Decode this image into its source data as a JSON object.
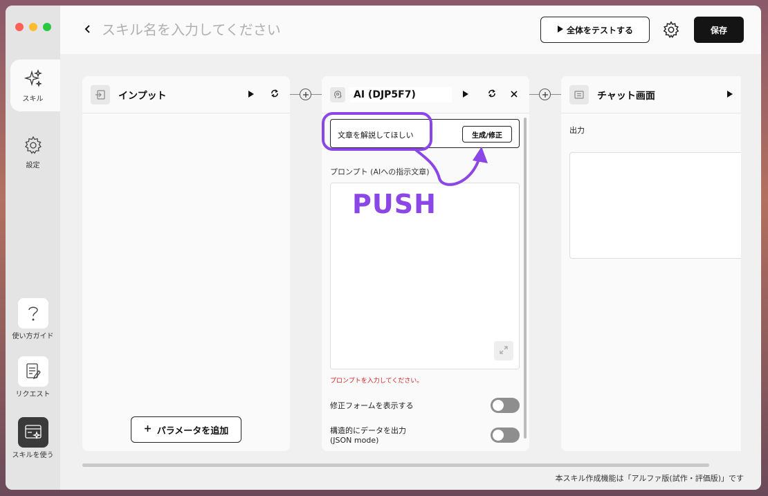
{
  "sidebar": {
    "items": [
      {
        "label": "スキル",
        "icon": "sparkle-icon"
      },
      {
        "label": "設定",
        "icon": "gear-icon"
      }
    ],
    "bottom": [
      {
        "label": "使い方ガイド",
        "icon": "question-icon"
      },
      {
        "label": "リクエスト",
        "icon": "note-edit-icon"
      },
      {
        "label": "スキルを使う",
        "icon": "skill-use-icon"
      }
    ]
  },
  "header": {
    "title_placeholder": "スキル名を入力してください",
    "test_all_label": "全体をテストする",
    "save_label": "保存"
  },
  "panels": {
    "input": {
      "title": "インプット",
      "add_param_label": "パラメータを追加"
    },
    "ai": {
      "title": "AI (DJP5F7)",
      "generate_input_value": "文章を解説してほしい",
      "generate_button_label": "生成/修正",
      "prompt_label": "プロンプト (AIへの指示文章)",
      "prompt_error": "プロンプトを入力してください。",
      "toggle_fix_form_label": "修正フォームを表示する",
      "toggle_json_label_1": "構造的にデータを出力",
      "toggle_json_label_2": "(JSON mode)"
    },
    "chat": {
      "title": "チャット画面",
      "output_label": "出力"
    }
  },
  "annotation": {
    "text": "PUSH",
    "color": "#8b46e6"
  },
  "footer": {
    "notice": "本スキル作成機能は「アルファ版(試作・評価版)」です"
  },
  "colors": {
    "accent": "#141414",
    "annotation": "#8b46e6",
    "error": "#d02020"
  }
}
